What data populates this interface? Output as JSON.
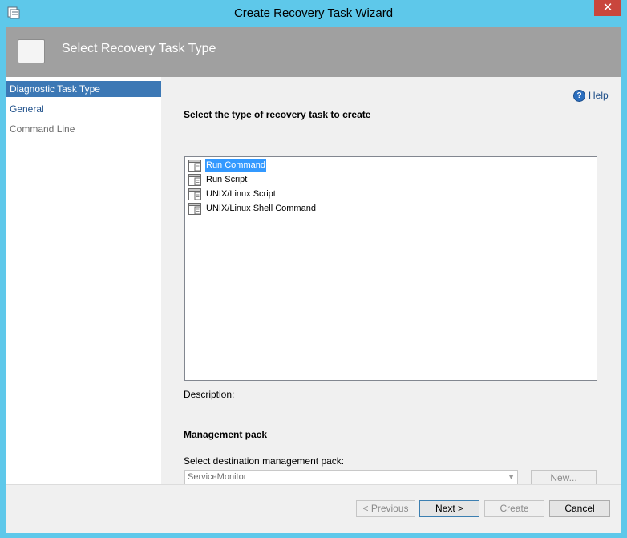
{
  "window": {
    "title": "Create Recovery Task Wizard",
    "close_glyph": "✕"
  },
  "header": {
    "title": "Select Recovery Task Type"
  },
  "nav": {
    "items": [
      {
        "label": "Diagnostic Task Type",
        "state": "selected"
      },
      {
        "label": "General",
        "state": "link"
      },
      {
        "label": "Command Line",
        "state": "disabled"
      }
    ]
  },
  "content": {
    "help_label": "Help",
    "help_glyph": "?",
    "section_title": "Select the type of recovery task to create",
    "task_types": [
      {
        "label": "Run Command",
        "selected": true
      },
      {
        "label": "Run Script",
        "selected": false
      },
      {
        "label": "UNIX/Linux Script",
        "selected": false
      },
      {
        "label": "UNIX/Linux Shell Command",
        "selected": false
      }
    ],
    "description_label": "Description:",
    "management_pack": {
      "section_title": "Management pack",
      "field_label": "Select destination management pack:",
      "selected_value": "ServiceMonitor",
      "arrow_glyph": "▼",
      "new_button_label": "New..."
    }
  },
  "footer": {
    "previous_label": "< Previous",
    "next_label": "Next >",
    "create_label": "Create",
    "cancel_label": "Cancel"
  },
  "colors": {
    "window_frame": "#5ec8ea",
    "close_button": "#c9463d",
    "header_band": "#a0a0a0",
    "nav_selected": "#3c78b5",
    "list_selection": "#3399ff"
  }
}
